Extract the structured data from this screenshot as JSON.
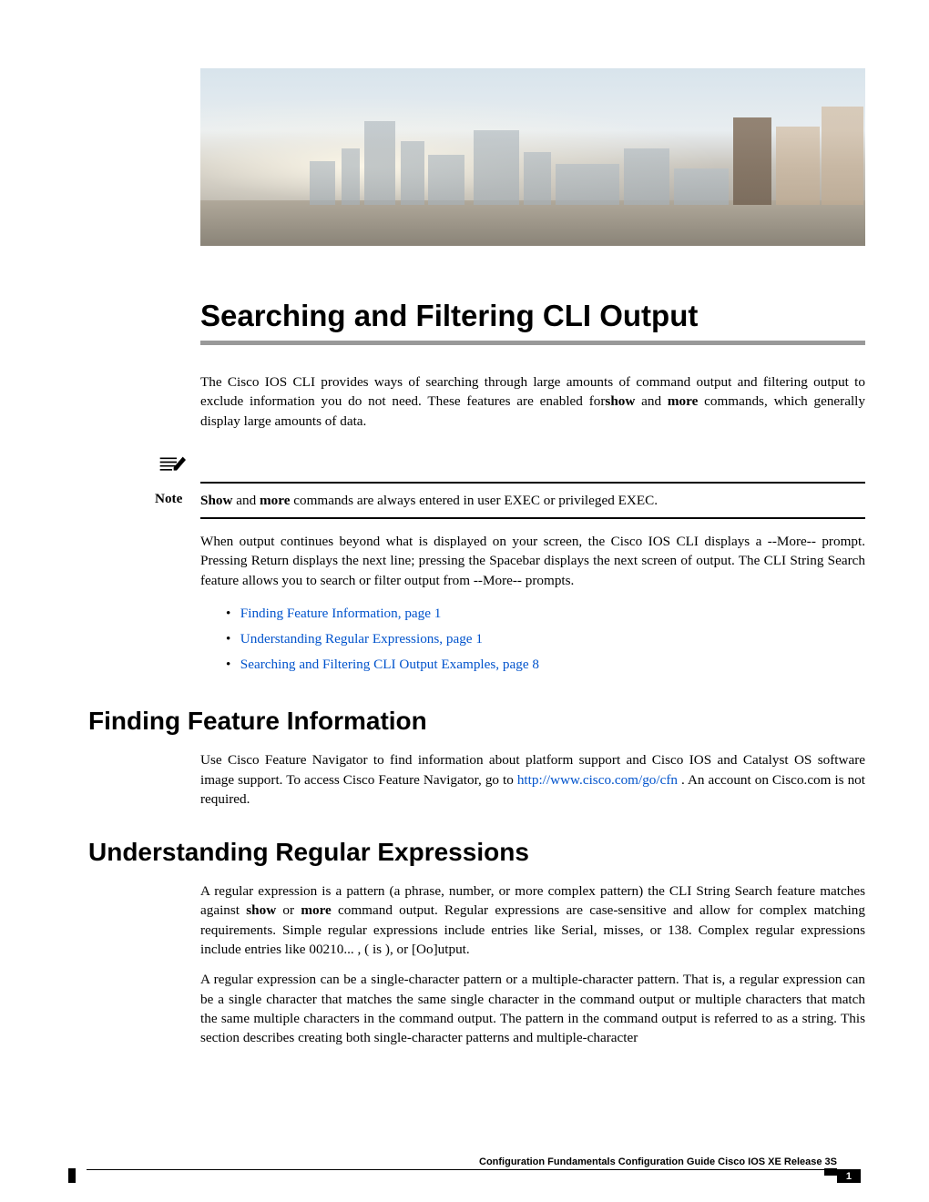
{
  "title": "Searching and Filtering CLI Output",
  "intro": {
    "p1_pre": "The Cisco IOS CLI provides ways of searching through large amounts of command output and filtering output to exclude information you do not need. These features are enabled for",
    "p1_bold1": "show",
    "p1_mid": " and ",
    "p1_bold2": "more",
    "p1_post": " commands, which generally display large amounts of data."
  },
  "note": {
    "label": "Note",
    "bold1": "Show",
    "mid1": "  and ",
    "bold2": "more",
    "post": " commands are always entered in user EXEC or privileged EXEC."
  },
  "intro2": "When output continues beyond what is displayed on your screen, the Cisco IOS CLI displays a --More-- prompt. Pressing Return displays the next line; pressing the Spacebar displays the next screen of output. The CLI String Search feature allows you to search or filter output from --More-- prompts.",
  "toc": [
    {
      "text": "Finding Feature Information,  page  1"
    },
    {
      "text": "Understanding Regular Expressions,  page  1"
    },
    {
      "text": "Searching and Filtering CLI Output Examples,  page  8"
    }
  ],
  "section1": {
    "heading": "Finding Feature Information",
    "p1_pre": "Use Cisco Feature Navigator to find information about platform support and Cisco IOS and Catalyst OS software image support. To access Cisco Feature Navigator, go to ",
    "link": "http://www.cisco.com/go/cfn",
    "p1_post": " . An account on Cisco.com is not required."
  },
  "section2": {
    "heading": "Understanding Regular Expressions",
    "p1_pre": "A regular expression is a pattern (a phrase, number, or more complex pattern) the CLI String Search feature matches against ",
    "bold1": "show",
    "mid1": " or ",
    "bold2": "more",
    "p1_post": " command output. Regular expressions are case-sensitive and allow for complex matching requirements. Simple regular expressions include entries like Serial, misses, or 138. Complex regular expressions include entries like 00210... , ( is ), or [Oo]utput.",
    "p2": "A regular expression can be a single-character pattern or a multiple-character pattern. That is, a regular expression can be a single character that matches the same single character in the command output or multiple characters that match the same multiple characters in the command output. The pattern in the command output is referred to as a string. This section describes creating both single-character patterns and multiple-character"
  },
  "footer": {
    "guide": "Configuration Fundamentals Configuration Guide Cisco IOS XE Release 3S",
    "page": "1"
  }
}
